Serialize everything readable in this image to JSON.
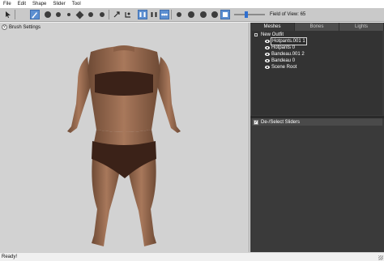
{
  "menu": [
    "File",
    "Edit",
    "Shape",
    "Slider",
    "Tool"
  ],
  "toolbar": {
    "field_of_view": "Field of View: 65",
    "tools": [
      "select-tool",
      "brush-tool",
      "inflate-tool",
      "deflate-tool",
      "move-tool",
      "smooth-tool",
      "undiff-tool",
      "mask-tool",
      "transform-tool",
      "pivot-tool",
      "x-mirror",
      "connected-only",
      "weight-tool"
    ],
    "accent": "#5c8fd1"
  },
  "viewport": {
    "brush_settings": "Brush Settings",
    "background": "#d2d2d2",
    "model": "3D character body model with brown bandeau top and hotpants"
  },
  "panel": {
    "tabs": [
      "Meshes",
      "Bones",
      "Lights"
    ],
    "selected_tab": "Meshes",
    "tree": {
      "root": "New Outfit",
      "items": [
        "Hotpants.001 1",
        "Hotpants 0",
        "Bandeau.001 2",
        "Bandeau 0",
        "Scene Root"
      ],
      "selected": "Hotpants.001 1"
    },
    "sliders_header": "De-/Select Sliders"
  },
  "status": "Ready!"
}
